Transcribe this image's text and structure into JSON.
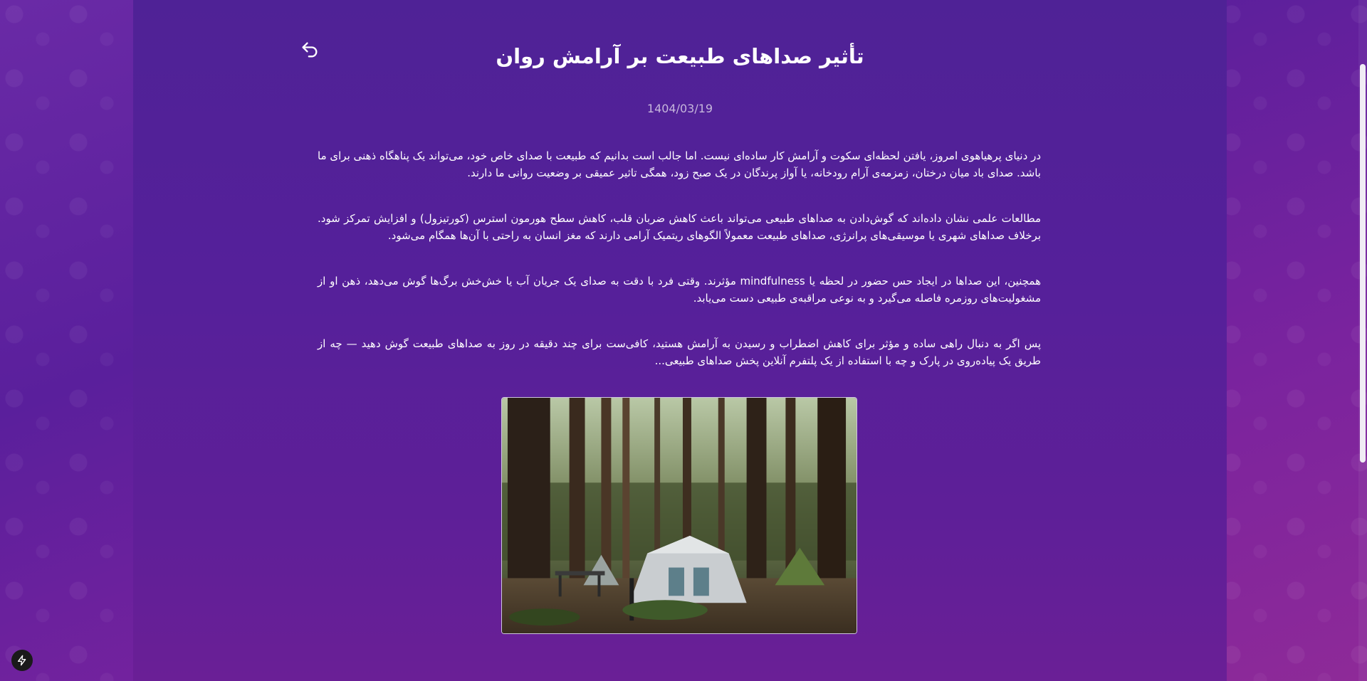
{
  "article": {
    "title": "تأثیر صداهای طبیعت بر آرامش روان",
    "date": "1404/03/19",
    "paragraphs": [
      "در دنیای پرهیاهوی امروز، یافتن لحظه‌ای سکوت و آرامش کار ساده‌ای نیست. اما جالب است بدانیم که طبیعت با صدای خاص خود، می‌تواند یک پناهگاه ذهنی برای ما باشد. صدای باد میان درختان، زمزمه‌ی آرام رودخانه، یا آواز پرندگان در یک صبح زود، همگی تاثیر عمیقی بر وضعیت روانی ما دارند.",
      "مطالعات علمی نشان داده‌اند که گوش‌دادن به صداهای طبیعی می‌تواند باعث کاهش ضربان قلب، کاهش سطح هورمون استرس (کورتیزول) و افزایش تمرکز شود. برخلاف صداهای شهری یا موسیقی‌های پرانرژی، صداهای طبیعت معمولاً الگوهای ریتمیک آرامی دارند که مغز انسان به راحتی با آن‌ها همگام می‌شود.",
      "همچنین، این صداها در ایجاد حس حضور در لحظه یا mindfulness مؤثرند. وقتی فرد با دقت به صدای یک جریان آب یا خش‌خش برگ‌ها گوش می‌دهد، ذهن او از مشغولیت‌های روزمره فاصله می‌گیرد و به نوعی مراقبه‌ی طبیعی دست می‌یابد.",
      "پس اگر به دنبال راهی ساده و مؤثر برای کاهش اضطراب و رسیدن به آرامش هستید، کافی‌ست برای چند دقیقه در روز به صداهای طبیعت گوش دهید — چه از طریق یک پیاده‌روی در پارک و چه با استفاده از یک پلتفرم آنلاین پخش صداهای طبیعی..."
    ]
  },
  "icons": {
    "back": "back-arrow-icon",
    "quick_action": "lightning-icon"
  },
  "colors": {
    "background": "#5a1f9c",
    "panel": "#55209a",
    "text": "#ffffff",
    "date": "#c6b6dc"
  }
}
